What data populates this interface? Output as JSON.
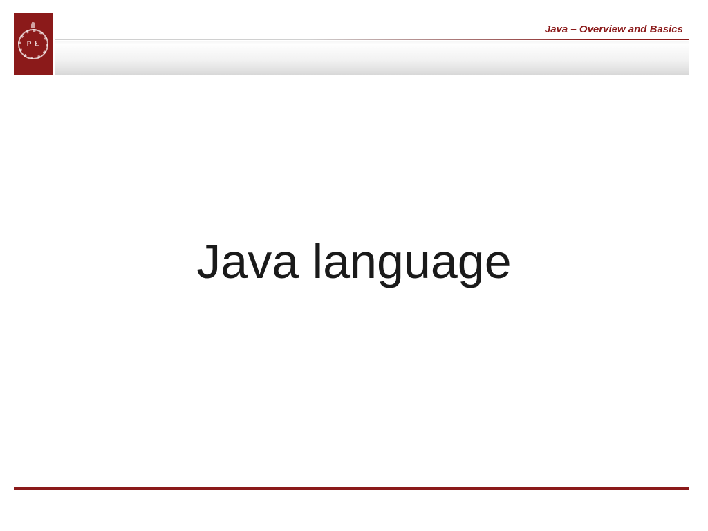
{
  "header": {
    "label": "Java – Overview and Basics",
    "logo_letters": "P Ł"
  },
  "main": {
    "title": "Java language"
  },
  "colors": {
    "accent": "#8b1a1a"
  }
}
